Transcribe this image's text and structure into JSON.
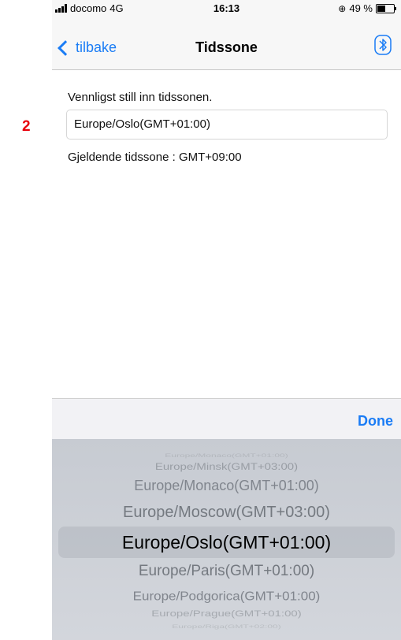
{
  "annotation": "2",
  "status_bar": {
    "carrier": "docomo",
    "network": "4G",
    "time": "16:13",
    "battery": "49 %"
  },
  "nav": {
    "back_label": "tilbake",
    "title": "Tidssone"
  },
  "form": {
    "prompt": "Vennligst still inn tidssonen.",
    "selected_value": "Europe/Oslo(GMT+01:00)",
    "current_label": "Gjeldende tidssone :",
    "current_value": "GMT+09:00"
  },
  "picker": {
    "done_label": "Done",
    "options": [
      "Europe/Monaco(GMT+01:00)",
      "Europe/Minsk(GMT+03:00)",
      "Europe/Monaco(GMT+01:00)",
      "Europe/Moscow(GMT+03:00)",
      "Europe/Oslo(GMT+01:00)",
      "Europe/Paris(GMT+01:00)",
      "Europe/Podgorica(GMT+01:00)",
      "Europe/Prague(GMT+01:00)",
      "Europe/Riga(GMT+02:00)"
    ],
    "selected_index": 4
  },
  "colors": {
    "accent": "#1a7cf5",
    "annotation": "#e8000b",
    "picker_bg": "#cdd0d6"
  }
}
